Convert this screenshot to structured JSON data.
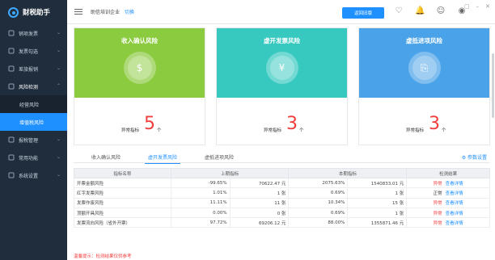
{
  "app": {
    "name": "财税助手"
  },
  "sidebar": {
    "items": [
      {
        "label": "销项发票",
        "icon": "invoice-icon"
      },
      {
        "label": "发票勾选",
        "icon": "check-icon"
      },
      {
        "label": "差旅报销",
        "icon": "reimburse-icon"
      },
      {
        "label": "风险检测",
        "icon": "risk-icon",
        "open": true
      },
      {
        "label": "经营风险",
        "sub": true
      },
      {
        "label": "增值税风险",
        "sub": true,
        "active": true
      },
      {
        "label": "报税管理",
        "icon": "tax-icon"
      },
      {
        "label": "常用功能",
        "icon": "grid-icon"
      },
      {
        "label": "系统设置",
        "icon": "gear-icon"
      }
    ]
  },
  "header": {
    "company": "助信培训企业",
    "switch": "切换",
    "back": "返回旧版"
  },
  "cards": [
    {
      "title": "收入确认风险",
      "label": "异常指标",
      "count": "5",
      "unit": "个",
      "color": "#8bcb3f"
    },
    {
      "title": "虚开发票风险",
      "label": "异常指标",
      "count": "3",
      "unit": "个",
      "color": "#37c9c0"
    },
    {
      "title": "虚抵进项风险",
      "label": "异常指标",
      "count": "3",
      "unit": "个",
      "color": "#4aa3e8"
    }
  ],
  "tabs": [
    "收入确认风险",
    "虚开发票风险",
    "虚抵进项风险"
  ],
  "params": "参数设置",
  "table": {
    "headers": [
      "指标名称",
      "上期指标",
      "本期指标",
      "检测结果"
    ],
    "rows": [
      {
        "name": "开票金额风险",
        "p1": "-99.65%",
        "p2": "70622.47 元",
        "c1": "2075.63%",
        "c2": "1540833.01 元",
        "result": "异常",
        "link": "查看详情",
        "abnormal": true
      },
      {
        "name": "红字发票风险",
        "p1": "1.01%",
        "p2": "1 张",
        "c1": "0.69%",
        "c2": "1 张",
        "result": "正常",
        "link": "查看详情",
        "abnormal": false
      },
      {
        "name": "发票作废风险",
        "p1": "11.11%",
        "p2": "11 张",
        "c1": "10.34%",
        "c2": "15 张",
        "result": "异常",
        "link": "查看详情",
        "abnormal": true
      },
      {
        "name": "顶额开具风险",
        "p1": "0.00%",
        "p2": "0 张",
        "c1": "0.69%",
        "c2": "1 张",
        "result": "异常",
        "link": "查看详情",
        "abnormal": true
      },
      {
        "name": "发票流向风险（省外开票）",
        "p1": "97.72%",
        "p2": "69206.12 元",
        "c1": "88.00%",
        "c2": "1355871.46 元",
        "result": "异常",
        "link": "查看详情",
        "abnormal": true
      }
    ]
  },
  "note": "温馨提示：检测结果仅供参考"
}
